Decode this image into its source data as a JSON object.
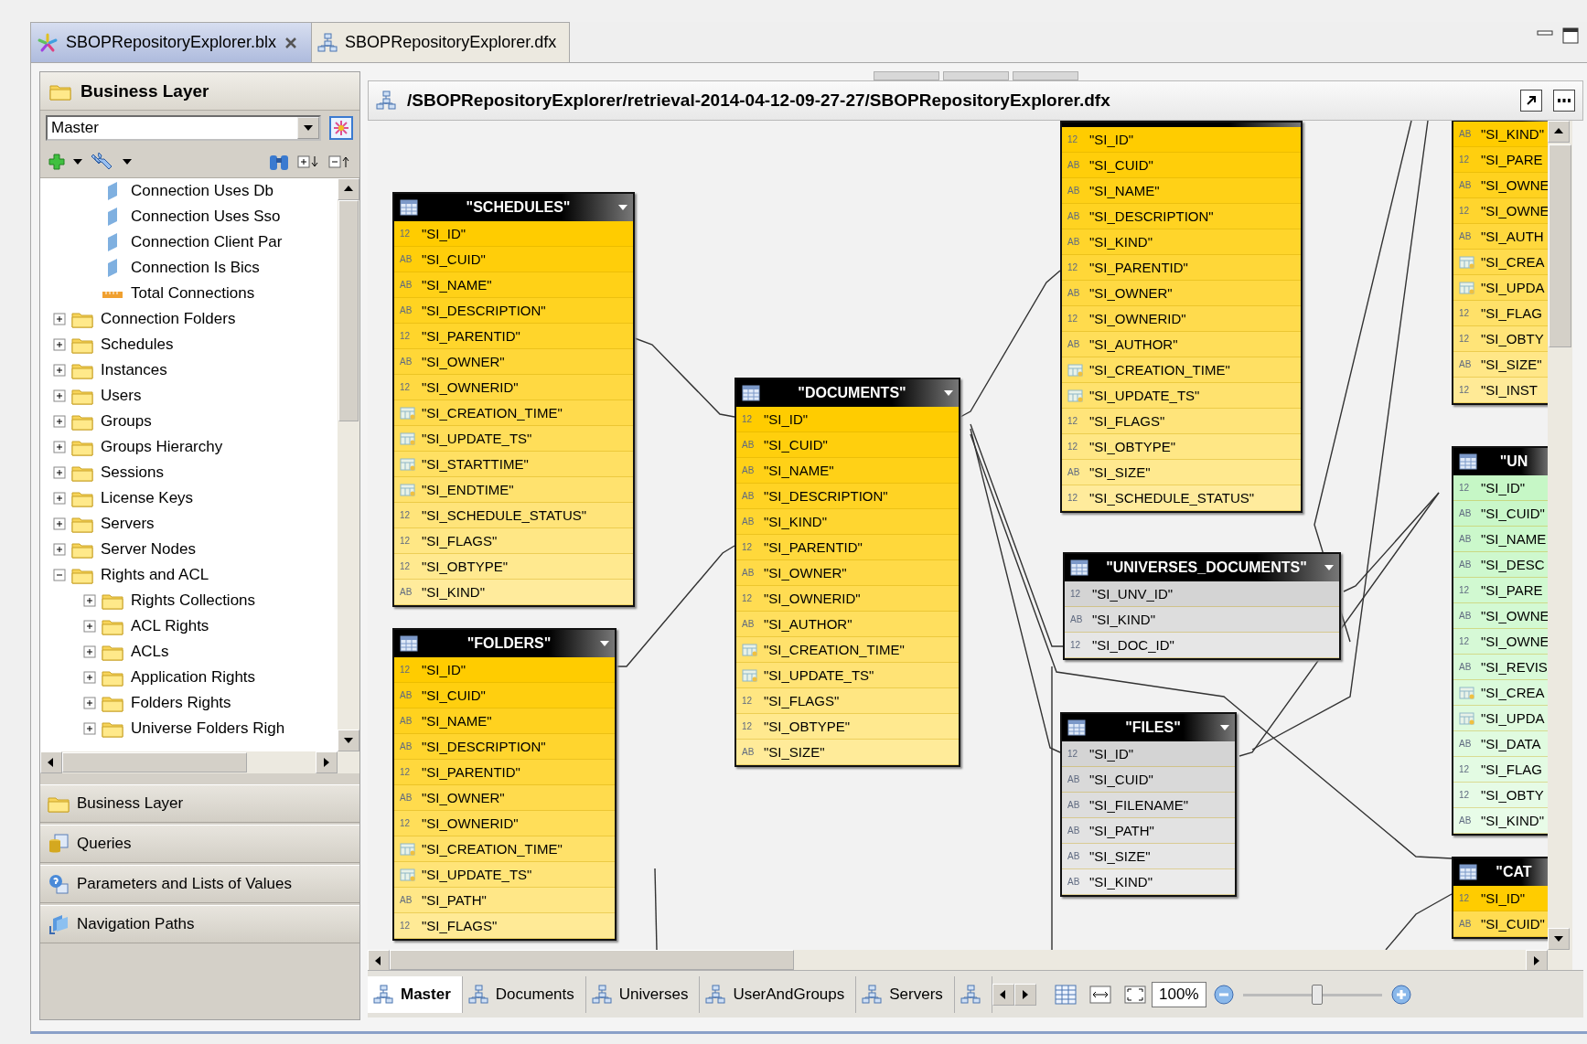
{
  "editor_tabs": [
    {
      "label": "SBOPRepositoryExplorer.blx",
      "selected": true,
      "closable": true,
      "kind": "layer"
    },
    {
      "label": "SBOPRepositoryExplorer.dfx",
      "selected": false,
      "closable": false,
      "kind": "foundation"
    }
  ],
  "left_panel": {
    "title": "Business Layer",
    "view_select": {
      "value": "Master"
    },
    "tree": [
      {
        "children": [
          {
            "label": "Connection Uses Db",
            "kind": "object"
          },
          {
            "label": "Connection Uses Sso",
            "kind": "object"
          },
          {
            "label": "Connection Client Par",
            "kind": "object"
          },
          {
            "label": "Connection Is Bics",
            "kind": "object"
          },
          {
            "label": "Total Connections",
            "kind": "measure"
          }
        ]
      },
      {
        "label": "Connection Folders",
        "kind": "folder",
        "expanded": false
      },
      {
        "label": "Schedules",
        "kind": "folder",
        "expanded": false
      },
      {
        "label": "Instances",
        "kind": "folder",
        "expanded": false
      },
      {
        "label": "Users",
        "kind": "folder",
        "expanded": false
      },
      {
        "label": "Groups",
        "kind": "folder",
        "expanded": false
      },
      {
        "label": "Groups Hierarchy",
        "kind": "folder",
        "expanded": false
      },
      {
        "label": "Sessions",
        "kind": "folder",
        "expanded": false
      },
      {
        "label": "License Keys",
        "kind": "folder",
        "expanded": false
      },
      {
        "label": "Servers",
        "kind": "folder",
        "expanded": false
      },
      {
        "label": "Server Nodes",
        "kind": "folder",
        "expanded": false
      },
      {
        "label": "Rights and ACL",
        "kind": "folder",
        "expanded": true,
        "children": [
          {
            "label": "Rights Collections",
            "kind": "folder",
            "expanded": false
          },
          {
            "label": "ACL Rights",
            "kind": "folder",
            "expanded": false
          },
          {
            "label": "ACLs",
            "kind": "folder",
            "expanded": false
          },
          {
            "label": "Application Rights",
            "kind": "folder",
            "expanded": false
          },
          {
            "label": "Folders Rights",
            "kind": "folder",
            "expanded": false
          },
          {
            "label": "Universe Folders Righ",
            "kind": "folder",
            "expanded": false
          }
        ]
      }
    ],
    "sections": [
      {
        "label": "Business Layer",
        "kind": "folder"
      },
      {
        "label": "Queries",
        "kind": "queries"
      },
      {
        "label": "Parameters and Lists of Values",
        "kind": "parameters"
      },
      {
        "label": "Navigation Paths",
        "kind": "paths"
      }
    ]
  },
  "diagram": {
    "path": "/SBOPRepositoryExplorer/retrieval-2014-04-12-09-27-27/SBOPRepositoryExplorer.dfx",
    "tables": [
      {
        "title": "\"SCHEDULES\"",
        "color": "#ffcc00",
        "rows": [
          {
            "kind": "tag",
            "tag": "12",
            "name": "\"SI_ID\""
          },
          {
            "kind": "tag",
            "tag": "AB",
            "name": "\"SI_CUID\""
          },
          {
            "kind": "tag",
            "tag": "AB",
            "name": "\"SI_NAME\""
          },
          {
            "kind": "tag",
            "tag": "AB",
            "name": "\"SI_DESCRIPTION\""
          },
          {
            "kind": "tag",
            "tag": "12",
            "name": "\"SI_PARENTID\""
          },
          {
            "kind": "tag",
            "tag": "AB",
            "name": "\"SI_OWNER\""
          },
          {
            "kind": "tag",
            "tag": "12",
            "name": "\"SI_OWNERID\""
          },
          {
            "kind": "date",
            "name": "\"SI_CREATION_TIME\""
          },
          {
            "kind": "date",
            "name": "\"SI_UPDATE_TS\""
          },
          {
            "kind": "date",
            "name": "\"SI_STARTTIME\""
          },
          {
            "kind": "date",
            "name": "\"SI_ENDTIME\""
          },
          {
            "kind": "tag",
            "tag": "12",
            "name": "\"SI_SCHEDULE_STATUS\""
          },
          {
            "kind": "tag",
            "tag": "12",
            "name": "\"SI_FLAGS\""
          },
          {
            "kind": "tag",
            "tag": "12",
            "name": "\"SI_OBTYPE\""
          },
          {
            "kind": "tag",
            "tag": "AB",
            "name": "\"SI_KIND\""
          }
        ]
      },
      {
        "title": "\"FOLDERS\"",
        "color": "#ffcc00",
        "rows": [
          {
            "kind": "tag",
            "tag": "12",
            "name": "\"SI_ID\""
          },
          {
            "kind": "tag",
            "tag": "AB",
            "name": "\"SI_CUID\""
          },
          {
            "kind": "tag",
            "tag": "AB",
            "name": "\"SI_NAME\""
          },
          {
            "kind": "tag",
            "tag": "AB",
            "name": "\"SI_DESCRIPTION\""
          },
          {
            "kind": "tag",
            "tag": "12",
            "name": "\"SI_PARENTID\""
          },
          {
            "kind": "tag",
            "tag": "AB",
            "name": "\"SI_OWNER\""
          },
          {
            "kind": "tag",
            "tag": "12",
            "name": "\"SI_OWNERID\""
          },
          {
            "kind": "date",
            "name": "\"SI_CREATION_TIME\""
          },
          {
            "kind": "date",
            "name": "\"SI_UPDATE_TS\""
          },
          {
            "kind": "tag",
            "tag": "AB",
            "name": "\"SI_PATH\""
          },
          {
            "kind": "tag",
            "tag": "12",
            "name": "\"SI_FLAGS\""
          }
        ]
      },
      {
        "title": "\"DOCUMENTS\"",
        "color": "#ffcc00",
        "rows": [
          {
            "kind": "tag",
            "tag": "12",
            "name": "\"SI_ID\""
          },
          {
            "kind": "tag",
            "tag": "AB",
            "name": "\"SI_CUID\""
          },
          {
            "kind": "tag",
            "tag": "AB",
            "name": "\"SI_NAME\""
          },
          {
            "kind": "tag",
            "tag": "AB",
            "name": "\"SI_DESCRIPTION\""
          },
          {
            "kind": "tag",
            "tag": "AB",
            "name": "\"SI_KIND\""
          },
          {
            "kind": "tag",
            "tag": "12",
            "name": "\"SI_PARENTID\""
          },
          {
            "kind": "tag",
            "tag": "AB",
            "name": "\"SI_OWNER\""
          },
          {
            "kind": "tag",
            "tag": "12",
            "name": "\"SI_OWNERID\""
          },
          {
            "kind": "tag",
            "tag": "AB",
            "name": "\"SI_AUTHOR\""
          },
          {
            "kind": "date",
            "name": "\"SI_CREATION_TIME\""
          },
          {
            "kind": "date",
            "name": "\"SI_UPDATE_TS\""
          },
          {
            "kind": "tag",
            "tag": "12",
            "name": "\"SI_FLAGS\""
          },
          {
            "kind": "tag",
            "tag": "12",
            "name": "\"SI_OBTYPE\""
          },
          {
            "kind": "tag",
            "tag": "AB",
            "name": "\"SI_SIZE\""
          }
        ]
      },
      {
        "color": "#ffcc00",
        "rows": [
          {
            "kind": "tag",
            "tag": "12",
            "name": "\"SI_ID\""
          },
          {
            "kind": "tag",
            "tag": "AB",
            "name": "\"SI_CUID\""
          },
          {
            "kind": "tag",
            "tag": "AB",
            "name": "\"SI_NAME\""
          },
          {
            "kind": "tag",
            "tag": "AB",
            "name": "\"SI_DESCRIPTION\""
          },
          {
            "kind": "tag",
            "tag": "AB",
            "name": "\"SI_KIND\""
          },
          {
            "kind": "tag",
            "tag": "12",
            "name": "\"SI_PARENTID\""
          },
          {
            "kind": "tag",
            "tag": "AB",
            "name": "\"SI_OWNER\""
          },
          {
            "kind": "tag",
            "tag": "12",
            "name": "\"SI_OWNERID\""
          },
          {
            "kind": "tag",
            "tag": "AB",
            "name": "\"SI_AUTHOR\""
          },
          {
            "kind": "date",
            "name": "\"SI_CREATION_TIME\""
          },
          {
            "kind": "date",
            "name": "\"SI_UPDATE_TS\""
          },
          {
            "kind": "tag",
            "tag": "12",
            "name": "\"SI_FLAGS\""
          },
          {
            "kind": "tag",
            "tag": "12",
            "name": "\"SI_OBTYPE\""
          },
          {
            "kind": "tag",
            "tag": "AB",
            "name": "\"SI_SIZE\""
          },
          {
            "kind": "tag",
            "tag": "12",
            "name": "\"SI_SCHEDULE_STATUS\""
          }
        ]
      },
      {
        "title": "\"UNIVERSES_DOCUMENTS\"",
        "color": "#d4d4d4",
        "rows": [
          {
            "kind": "tag",
            "tag": "12",
            "name": "\"SI_UNV_ID\""
          },
          {
            "kind": "tag",
            "tag": "AB",
            "name": "\"SI_KIND\""
          },
          {
            "kind": "tag",
            "tag": "12",
            "name": "\"SI_DOC_ID\""
          }
        ]
      },
      {
        "title": "\"FILES\"",
        "color": "#d4d4d4",
        "rows": [
          {
            "kind": "tag",
            "tag": "12",
            "name": "\"SI_ID\""
          },
          {
            "kind": "tag",
            "tag": "AB",
            "name": "\"SI_CUID\""
          },
          {
            "kind": "tag",
            "tag": "AB",
            "name": "\"SI_FILENAME\""
          },
          {
            "kind": "tag",
            "tag": "AB",
            "name": "\"SI_PATH\""
          },
          {
            "kind": "tag",
            "tag": "AB",
            "name": "\"SI_SIZE\""
          },
          {
            "kind": "tag",
            "tag": "AB",
            "name": "\"SI_KIND\""
          }
        ]
      },
      {
        "color": "#ffcc00",
        "rows": [
          {
            "kind": "tag",
            "tag": "AB",
            "name": "\"SI_KIND\""
          },
          {
            "kind": "tag",
            "tag": "12",
            "name": "\"SI_PARE"
          },
          {
            "kind": "tag",
            "tag": "AB",
            "name": "\"SI_OWNE"
          },
          {
            "kind": "tag",
            "tag": "12",
            "name": "\"SI_OWNE"
          },
          {
            "kind": "tag",
            "tag": "AB",
            "name": "\"SI_AUTH"
          },
          {
            "kind": "date",
            "name": "\"SI_CREA"
          },
          {
            "kind": "date",
            "name": "\"SI_UPDA"
          },
          {
            "kind": "tag",
            "tag": "12",
            "name": "\"SI_FLAG"
          },
          {
            "kind": "tag",
            "tag": "12",
            "name": "\"SI_OBTY"
          },
          {
            "kind": "tag",
            "tag": "AB",
            "name": "\"SI_SIZE\""
          },
          {
            "kind": "tag",
            "tag": "12",
            "name": "\"SI_INST"
          }
        ]
      },
      {
        "title": "\"UN",
        "color": "#c6f7c6",
        "rows": [
          {
            "kind": "tag",
            "tag": "12",
            "name": "\"SI_ID\""
          },
          {
            "kind": "tag",
            "tag": "AB",
            "name": "\"SI_CUID\""
          },
          {
            "kind": "tag",
            "tag": "AB",
            "name": "\"SI_NAME"
          },
          {
            "kind": "tag",
            "tag": "AB",
            "name": "\"SI_DESC"
          },
          {
            "kind": "tag",
            "tag": "12",
            "name": "\"SI_PARE"
          },
          {
            "kind": "tag",
            "tag": "AB",
            "name": "\"SI_OWNE"
          },
          {
            "kind": "tag",
            "tag": "12",
            "name": "\"SI_OWNE"
          },
          {
            "kind": "tag",
            "tag": "AB",
            "name": "\"SI_REVIS"
          },
          {
            "kind": "date",
            "name": "\"SI_CREA"
          },
          {
            "kind": "date",
            "name": "\"SI_UPDA"
          },
          {
            "kind": "tag",
            "tag": "AB",
            "name": "\"SI_DATA"
          },
          {
            "kind": "tag",
            "tag": "12",
            "name": "\"SI_FLAG"
          },
          {
            "kind": "tag",
            "tag": "12",
            "name": "\"SI_OBTY"
          },
          {
            "kind": "tag",
            "tag": "AB",
            "name": "\"SI_KIND\""
          }
        ]
      },
      {
        "title": "\"CAT",
        "color": "#ffcc00",
        "rows": [
          {
            "kind": "tag",
            "tag": "12",
            "name": "\"SI_ID\""
          },
          {
            "kind": "tag",
            "tag": "AB",
            "name": "\"SI_CUID\""
          }
        ]
      }
    ]
  },
  "view_tabs": [
    {
      "label": "Master",
      "selected": true
    },
    {
      "label": "Documents",
      "selected": false
    },
    {
      "label": "Universes",
      "selected": false
    },
    {
      "label": "UserAndGroups",
      "selected": false
    },
    {
      "label": "Servers",
      "selected": false
    },
    {
      "selected": false
    }
  ],
  "zoom": {
    "value": "100%",
    "level": 0.53
  }
}
